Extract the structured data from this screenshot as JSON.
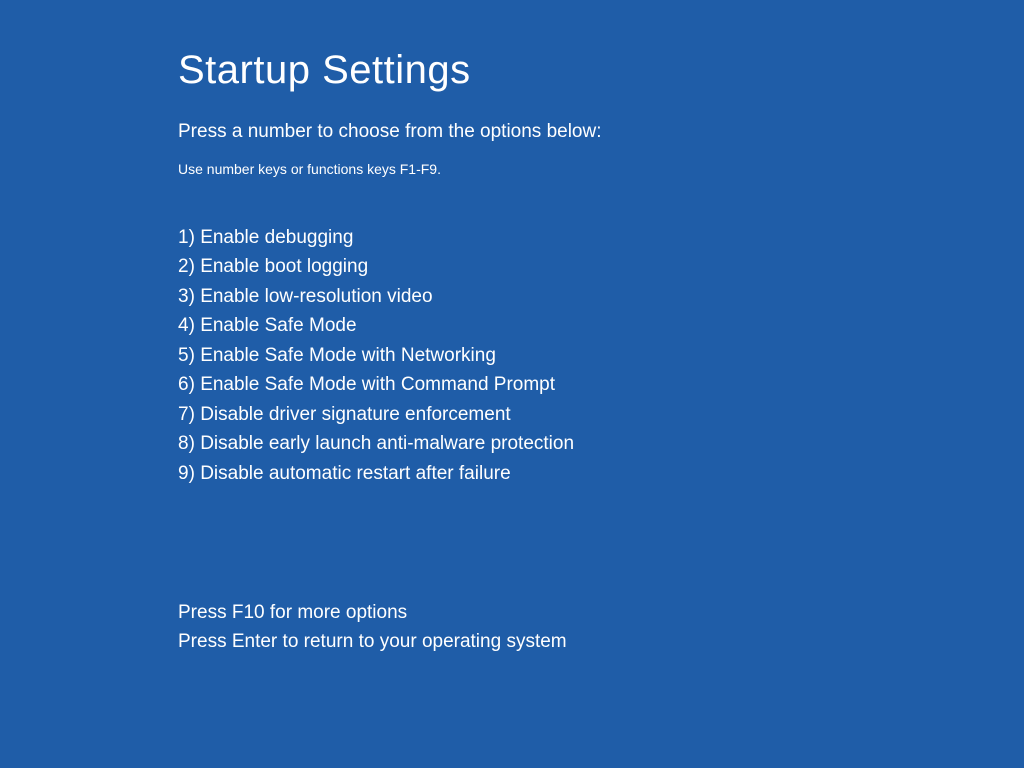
{
  "title": "Startup Settings",
  "subtitle": "Press a number to choose from the options below:",
  "hint": "Use number keys or functions keys F1-F9.",
  "options": [
    {
      "num": "1",
      "label": "Enable debugging"
    },
    {
      "num": "2",
      "label": "Enable boot logging"
    },
    {
      "num": "3",
      "label": "Enable low-resolution video"
    },
    {
      "num": "4",
      "label": "Enable Safe Mode"
    },
    {
      "num": "5",
      "label": "Enable Safe Mode with Networking"
    },
    {
      "num": "6",
      "label": "Enable Safe Mode with Command Prompt"
    },
    {
      "num": "7",
      "label": "Disable driver signature enforcement"
    },
    {
      "num": "8",
      "label": "Disable early launch anti-malware protection"
    },
    {
      "num": "9",
      "label": "Disable automatic restart after failure"
    }
  ],
  "footer": {
    "more": "Press F10 for more options",
    "return": "Press Enter to return to your operating system"
  }
}
